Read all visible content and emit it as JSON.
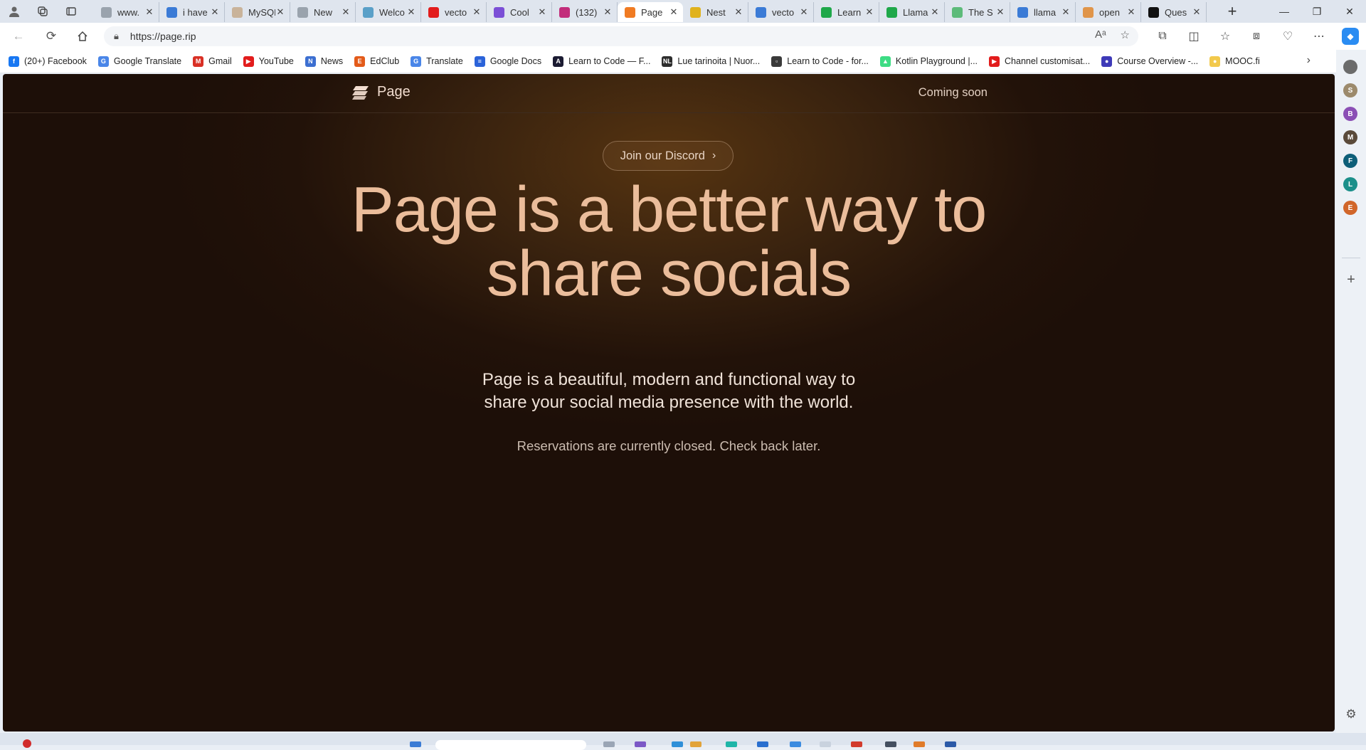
{
  "browser": {
    "tabs": [
      {
        "title": "www.",
        "favicon": "doc-icon",
        "color": "#9aa3ad"
      },
      {
        "title": "i have",
        "favicon": "search-icon",
        "color": "#3b7bd6"
      },
      {
        "title": "MySQL",
        "favicon": "app-icon",
        "color": "#c9b39a"
      },
      {
        "title": "New",
        "favicon": "newtab-icon",
        "color": "#9aa3ad"
      },
      {
        "title": "Welco",
        "favicon": "globe-icon",
        "color": "#5aa0c8"
      },
      {
        "title": "vecto",
        "favicon": "youtube-icon",
        "color": "#e21c1c"
      },
      {
        "title": "Cool",
        "favicon": "c-icon",
        "color": "#7b4fd6"
      },
      {
        "title": "(132)",
        "favicon": "notification-icon",
        "color": "#c22d7b"
      },
      {
        "title": "Page",
        "favicon": "page-icon",
        "color": "#f07b23",
        "active": true
      },
      {
        "title": "Nest",
        "favicon": "nest-icon",
        "color": "#e0b21c"
      },
      {
        "title": "vecto",
        "favicon": "search-icon",
        "color": "#3b7bd6"
      },
      {
        "title": "Learn",
        "favicon": "learn-icon",
        "color": "#1fa84a"
      },
      {
        "title": "Llama",
        "favicon": "learn-icon",
        "color": "#1fa84a"
      },
      {
        "title": "The S",
        "favicon": "learn-icon",
        "color": "#5dbb7a"
      },
      {
        "title": "llama",
        "favicon": "search-icon",
        "color": "#3b7bd6"
      },
      {
        "title": "open",
        "favicon": "hand-icon",
        "color": "#e0954a"
      },
      {
        "title": "Ques",
        "favicon": "question-icon",
        "color": "#111111"
      }
    ],
    "url": "https://page.rip",
    "bookmarks": [
      {
        "label": "(20+) Facebook",
        "icon": "facebook-icon",
        "color": "#1877f2",
        "glyph": "f"
      },
      {
        "label": "Google Translate",
        "icon": "translate-icon",
        "color": "#4a86e8",
        "glyph": "G"
      },
      {
        "label": "Gmail",
        "icon": "gmail-icon",
        "color": "#d93025",
        "glyph": "M"
      },
      {
        "label": "YouTube",
        "icon": "youtube-icon",
        "color": "#e21c1c",
        "glyph": "▶"
      },
      {
        "label": "News",
        "icon": "news-icon",
        "color": "#3c6fd1",
        "glyph": "N"
      },
      {
        "label": "EdClub",
        "icon": "edclub-icon",
        "color": "#e35b1a",
        "glyph": "E"
      },
      {
        "label": "Translate",
        "icon": "translate-icon",
        "color": "#4a86e8",
        "glyph": "G"
      },
      {
        "label": "Google Docs",
        "icon": "docs-icon",
        "color": "#2b63d9",
        "glyph": "≡"
      },
      {
        "label": "Learn to Code — F...",
        "icon": "fcc-icon",
        "color": "#1b1b32",
        "glyph": "A"
      },
      {
        "label": "Lue tarinoita | Nuor...",
        "icon": "nl-icon",
        "color": "#2d2d2d",
        "glyph": "NL"
      },
      {
        "label": "Learn to Code - for...",
        "icon": "doc-icon",
        "color": "#3a3a3a",
        "glyph": "▫"
      },
      {
        "label": "Kotlin Playground |...",
        "icon": "android-icon",
        "color": "#3ddc84",
        "glyph": "▲"
      },
      {
        "label": "Channel customisat...",
        "icon": "youtube-icon",
        "color": "#e21c1c",
        "glyph": "▶"
      },
      {
        "label": "Course Overview -...",
        "icon": "course-icon",
        "color": "#3e3ab8",
        "glyph": "●"
      },
      {
        "label": "MOOC.fi",
        "icon": "mooc-icon",
        "color": "#f2c94c",
        "glyph": "●"
      }
    ],
    "sidebar_profiles": [
      {
        "letter": "",
        "color": "#6b6b6b"
      },
      {
        "letter": "S",
        "color": "#9c8a6c"
      },
      {
        "letter": "B",
        "color": "#8b4fb5"
      },
      {
        "letter": "M",
        "color": "#5a4a3a"
      },
      {
        "letter": "F",
        "color": "#0d5e78"
      },
      {
        "letter": "L",
        "color": "#1b8f8a"
      },
      {
        "letter": "E",
        "color": "#d1662a"
      }
    ]
  },
  "site": {
    "brand": "Page",
    "nav_right": "Coming soon",
    "discord_button": "Join our Discord",
    "headline_line1": "Page is a better way to",
    "headline_line2": "share socials",
    "subtitle_line1": "Page is a beautiful, modern and functional way to",
    "subtitle_line2": "share your social media presence with the world.",
    "status": "Reservations are currently closed. Check back later."
  }
}
